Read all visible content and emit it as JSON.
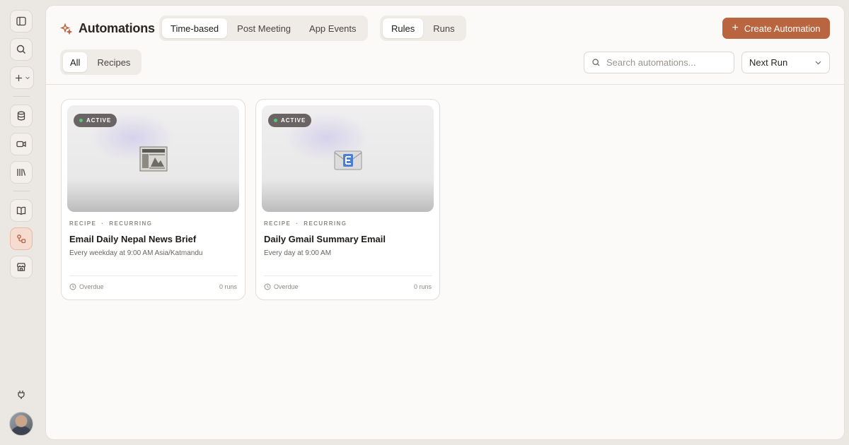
{
  "header": {
    "title": "Automations",
    "tabs": [
      "Time-based",
      "Post Meeting",
      "App Events"
    ],
    "active_tab": "Time-based",
    "view_tabs": [
      "Rules",
      "Runs"
    ],
    "active_view": "Rules",
    "create_label": "Create Automation"
  },
  "filters": {
    "chips": [
      "All",
      "Recipes"
    ],
    "active_chip": "All",
    "search_placeholder": "Search automations...",
    "sort_value": "Next Run"
  },
  "cards": [
    {
      "status": "ACTIVE",
      "type": "RECIPE",
      "frequency": "RECURRING",
      "title": "Email Daily Nepal News Brief",
      "schedule": "Every weekday at 9:00 AM Asia/Katmandu",
      "next_run": "Overdue",
      "runs": "0 runs",
      "icon": "newspaper-icon"
    },
    {
      "status": "ACTIVE",
      "type": "RECIPE",
      "frequency": "RECURRING",
      "title": "Daily Gmail Summary Email",
      "schedule": "Every day at 9:00 AM",
      "next_run": "Overdue",
      "runs": "0 runs",
      "icon": "envelope-icon"
    }
  ],
  "colors": {
    "accent": "#b9653f",
    "active_dot": "#56c57a"
  }
}
